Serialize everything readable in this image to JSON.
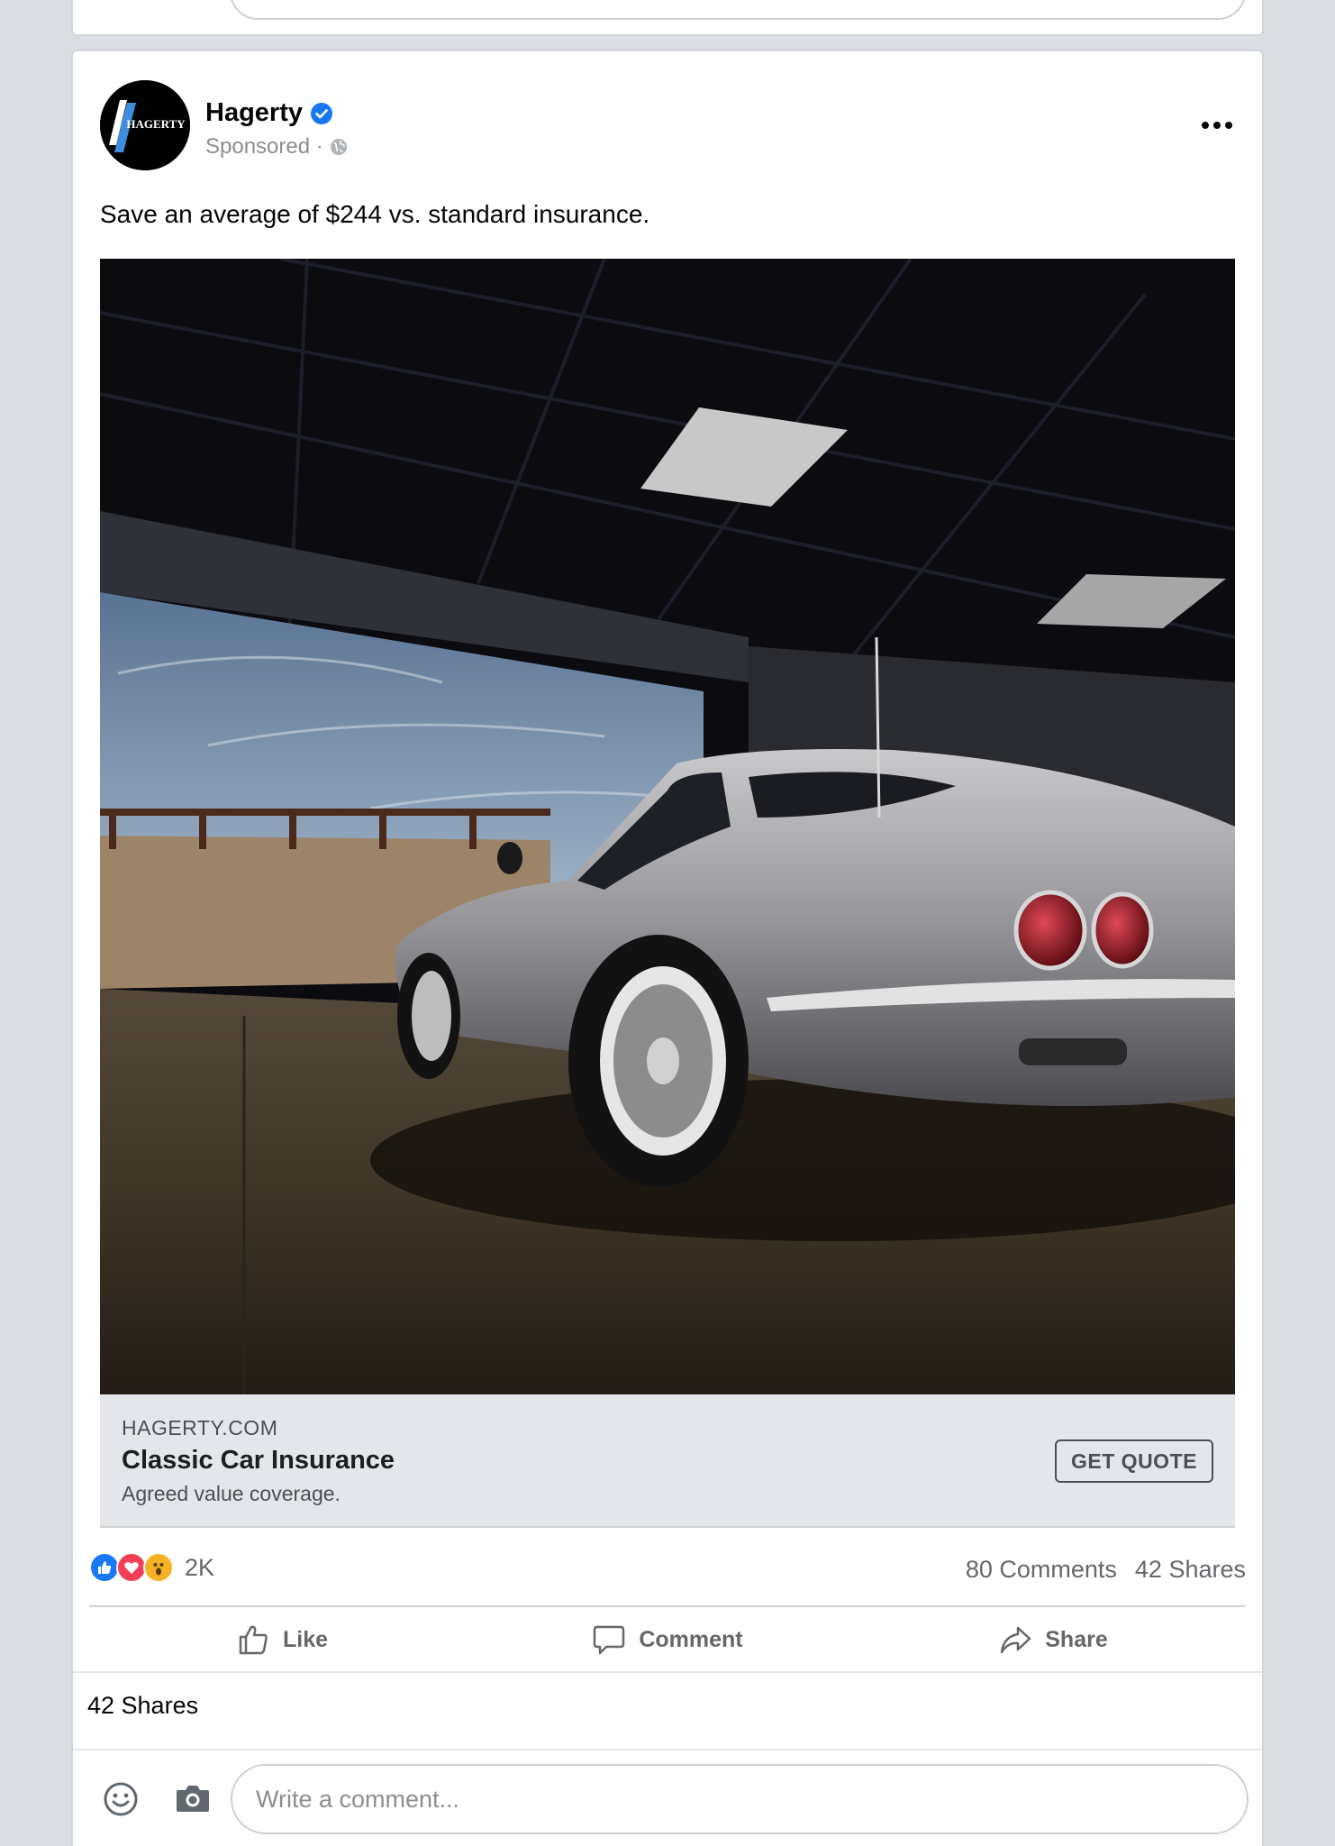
{
  "post": {
    "page_name": "Hagerty",
    "sponsored_label": "Sponsored ·",
    "avatar_logo_text": "HAGERTY",
    "text": "Save an average of $244 vs. standard insurance.",
    "more_icon": "more-horizontal-icon",
    "verified_icon": "verified-badge-icon",
    "globe_icon": "globe-icon"
  },
  "link_preview": {
    "domain": "HAGERTY.COM",
    "title": "Classic Car Insurance",
    "description": "Agreed value coverage.",
    "cta_label": "GET QUOTE"
  },
  "engagement": {
    "reaction_icons": [
      "like-reaction-icon",
      "love-reaction-icon",
      "wow-reaction-icon"
    ],
    "reaction_count": "2K",
    "comments": "80 Comments",
    "shares": "42 Shares"
  },
  "actions": {
    "like_label": "Like",
    "comment_label": "Comment",
    "share_label": "Share"
  },
  "shares_summary": "42 Shares",
  "composer": {
    "placeholder": "Write a comment..."
  },
  "colors": {
    "brand_blue": "#1877f2",
    "love_red": "#f33e58",
    "wow_yellow": "#f7b125",
    "feed_background": "#dadde1"
  }
}
